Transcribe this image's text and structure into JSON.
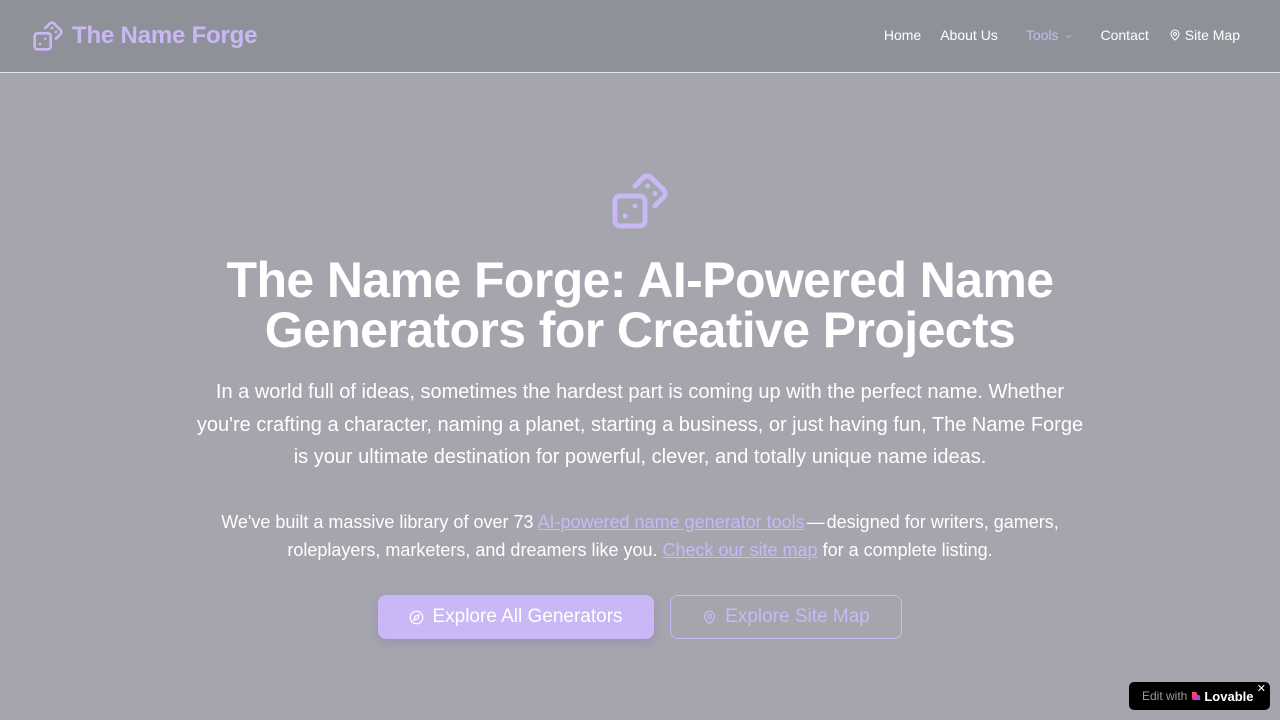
{
  "header": {
    "brand": "The Name Forge",
    "logo_icon": "dice-icon",
    "nav": {
      "home": "Home",
      "about": "About Us",
      "tools": "Tools",
      "contact": "Contact",
      "site_map": "Site Map"
    }
  },
  "hero": {
    "icon": "dice-icon",
    "title": "The Name Forge: AI-Powered Name Generators for Creative Projects",
    "lead": "In a world full of ideas, sometimes the hardest part is coming up with the perfect name. Whether you're crafting a character, naming a planet, starting a business, or just having fun, The Name Forge is your ultimate destination for powerful, clever, and totally unique name ideas.",
    "sub": {
      "before": "We've built a massive library of over 73 ",
      "link1": "AI-powered name generator tools",
      "dash": "—",
      "middle": "designed for writers, gamers, roleplayers, marketers, and dreamers like you. ",
      "link2": "Check our site map",
      "after": " for a complete listing."
    },
    "buttons": {
      "primary": "Explore All Generators",
      "secondary": "Explore Site Map"
    }
  },
  "badge": {
    "edit": "Edit with",
    "brand": "Lovable",
    "close": "✕"
  },
  "colors": {
    "accent": "#c9b8f5",
    "header_bg": "#8f9199",
    "page_bg": "#a5a5ae"
  }
}
